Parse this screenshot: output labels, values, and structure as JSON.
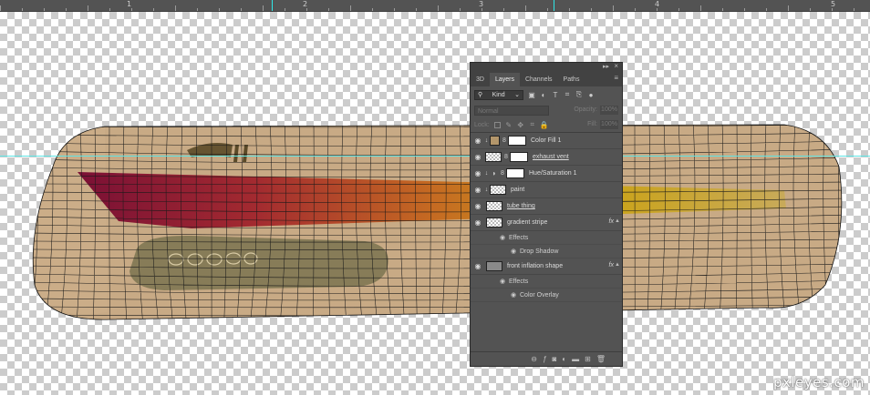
{
  "ruler": {
    "numbers": [
      "1",
      "2",
      "3",
      "4",
      "5"
    ]
  },
  "panel": {
    "tabs": [
      "3D",
      "Layers",
      "Channels",
      "Paths"
    ],
    "active_tab": "Layers",
    "kind_label": "Kind",
    "blend_mode": "Normal",
    "opacity_label": "Opacity:",
    "opacity_value": "100%",
    "lock_label": "Lock:",
    "fill_label": "Fill:",
    "fill_value": "100%",
    "layers": [
      {
        "name": "Color Fill 1",
        "underlined": false
      },
      {
        "name": "exhaust vent",
        "underlined": true
      },
      {
        "name": "Hue/Saturation 1",
        "underlined": false
      },
      {
        "name": "paint",
        "underlined": false
      },
      {
        "name": "tube thing",
        "underlined": true
      },
      {
        "name": "gradient stripe",
        "underlined": false,
        "effects_label": "Effects",
        "effect": "Drop Shadow"
      },
      {
        "name": "front inflation shape",
        "underlined": false,
        "effects_label": "Effects",
        "effect": "Color Overlay"
      }
    ],
    "fx_label": "fx"
  },
  "watermark": "pxleyes.com",
  "colors": {
    "panel_bg": "#535353",
    "panel_dark": "#424242",
    "shape_tan": "#c8aa85",
    "guide": "#5fe4e4",
    "color_fill_swatch": "#b3966b"
  }
}
